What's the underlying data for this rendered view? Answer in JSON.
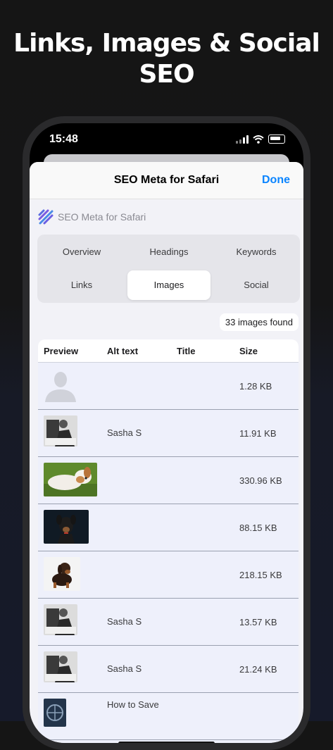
{
  "headline": "Links, Images & Social SEO",
  "status_bar": {
    "time": "15:48"
  },
  "nav": {
    "title": "SEO Meta for Safari",
    "done_label": "Done"
  },
  "brand": {
    "name": "SEO Meta for Safari",
    "icon": "stripes-logo-icon"
  },
  "tabs": [
    {
      "label": "Overview",
      "active": false
    },
    {
      "label": "Headings",
      "active": false
    },
    {
      "label": "Keywords",
      "active": false
    },
    {
      "label": "Links",
      "active": false
    },
    {
      "label": "Images",
      "active": true
    },
    {
      "label": "Social",
      "active": false
    }
  ],
  "images_count": "33 images found",
  "table": {
    "headers": {
      "preview": "Preview",
      "alt": "Alt text",
      "title": "Title",
      "size": "Size"
    },
    "rows": [
      {
        "thumb": "person-placeholder-icon",
        "alt": "",
        "title": "",
        "size": "1.28 KB"
      },
      {
        "thumb": "portrait-photo",
        "alt": "Sasha S",
        "title": "",
        "size": "11.91 KB"
      },
      {
        "thumb": "puppy-on-grass-photo",
        "alt": "",
        "title": "",
        "size": "330.96 KB"
      },
      {
        "thumb": "dark-dog-photo",
        "alt": "",
        "title": "",
        "size": "88.15 KB"
      },
      {
        "thumb": "dachshund-puppy-photo",
        "alt": "",
        "title": "",
        "size": "218.15 KB"
      },
      {
        "thumb": "portrait-photo",
        "alt": "Sasha S",
        "title": "",
        "size": "13.57 KB"
      },
      {
        "thumb": "portrait-photo",
        "alt": "Sasha S",
        "title": "",
        "size": "21.24 KB"
      },
      {
        "thumb": "wheel-photo",
        "alt": "How to Save",
        "title": "",
        "size": ""
      }
    ]
  },
  "colors": {
    "accent": "#0a84ff",
    "background": "#151515",
    "sheet": "#f2f2f7",
    "table_row": "#eef0fb"
  }
}
